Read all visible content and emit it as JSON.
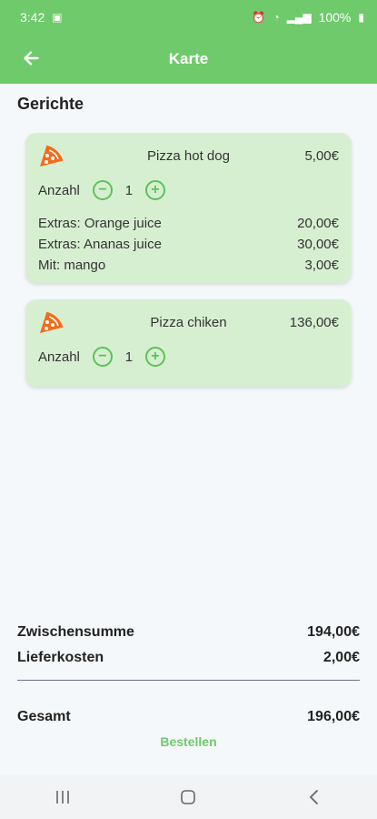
{
  "status_bar": {
    "time": "3:42",
    "battery": "100%"
  },
  "app_bar": {
    "title": "Karte"
  },
  "section": {
    "title": "Gerichte"
  },
  "cart_items": [
    {
      "name": "Pizza hot dog",
      "price": "5,00€",
      "qty_label": "Anzahl",
      "quantity": "1",
      "extras": [
        {
          "label": "Extras: Orange juice",
          "price": "20,00€"
        },
        {
          "label": "Extras: Ananas juice",
          "price": "30,00€"
        },
        {
          "label": "Mit: mango",
          "price": "3,00€"
        }
      ]
    },
    {
      "name": "Pizza chiken",
      "price": "136,00€",
      "qty_label": "Anzahl",
      "quantity": "1",
      "extras": []
    }
  ],
  "totals": {
    "subtotal_label": "Zwischensumme",
    "subtotal_value": "194,00€",
    "delivery_label": "Lieferkosten",
    "delivery_value": "2,00€",
    "total_label": "Gesamt",
    "total_value": "196,00€"
  },
  "order_button": {
    "label": "Bestellen"
  },
  "colors": {
    "brand": "#6fca6c",
    "card": "#d7efd1",
    "pizza_icon": "#f26c1a"
  },
  "icons": {
    "back": "arrow-left-icon",
    "pizza": "pizza-slice-icon",
    "minus": "minus-circle-icon",
    "plus": "plus-circle-icon"
  }
}
